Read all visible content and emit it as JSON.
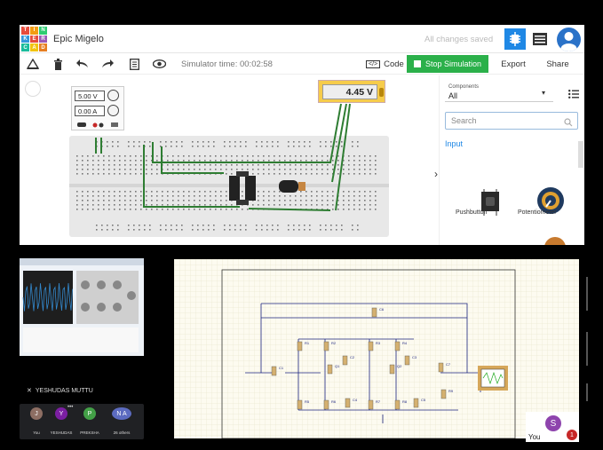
{
  "app": {
    "logo_letters": [
      "T",
      "I",
      "N",
      "K",
      "E",
      "R",
      "C",
      "A",
      "D"
    ],
    "logo_colors": [
      "#e74c3c",
      "#f39c12",
      "#2ecc71",
      "#3498db",
      "#e74c3c",
      "#9b59b6",
      "#1abc9c",
      "#f1c40f",
      "#e67e22"
    ],
    "project_name": "Epic Migelo",
    "save_status": "All changes saved",
    "accent_color": "#1f88e5"
  },
  "toolbar": {
    "simulator_time": "Simulator time: 00:02:58",
    "code_icon": "</>",
    "code_label": "Code",
    "stop_label": "Stop Simulation",
    "export_label": "Export",
    "share_label": "Share"
  },
  "workspace": {
    "psu_voltage": "5.00 V",
    "psu_current": "0.00 A",
    "multimeter_reading": "4.45 V"
  },
  "components_panel": {
    "filter_label": "Components",
    "filter_value": "All",
    "search_placeholder": "Search",
    "section_title": "Input",
    "items": [
      {
        "label": "Pushbutton",
        "icon": "pushbutton-icon"
      },
      {
        "label": "Potentiometer",
        "icon": "potentiometer-icon"
      }
    ]
  },
  "meeting": {
    "presenter_name": "YESHUDAS MUTTU",
    "participants": [
      {
        "initial": "J",
        "name": "You",
        "color": "#8d6e63"
      },
      {
        "initial": "Y",
        "name": "YESHUDAS",
        "color": "#7b1fa2"
      },
      {
        "initial": "P",
        "name": "PREKSHA",
        "color": "#43a047"
      },
      {
        "initial": "N A",
        "name": "26 others",
        "color": "#5c6bc0"
      }
    ],
    "self_initial": "S",
    "self_label": "You",
    "self_badge": "1"
  },
  "schematic": {
    "labels": [
      "R1",
      "R2",
      "R3",
      "R4",
      "R5",
      "R6",
      "R7",
      "R8",
      "R9",
      "Q1",
      "Q2",
      "C1",
      "C2",
      "C3",
      "C4",
      "C5",
      "C6",
      "C7"
    ]
  }
}
